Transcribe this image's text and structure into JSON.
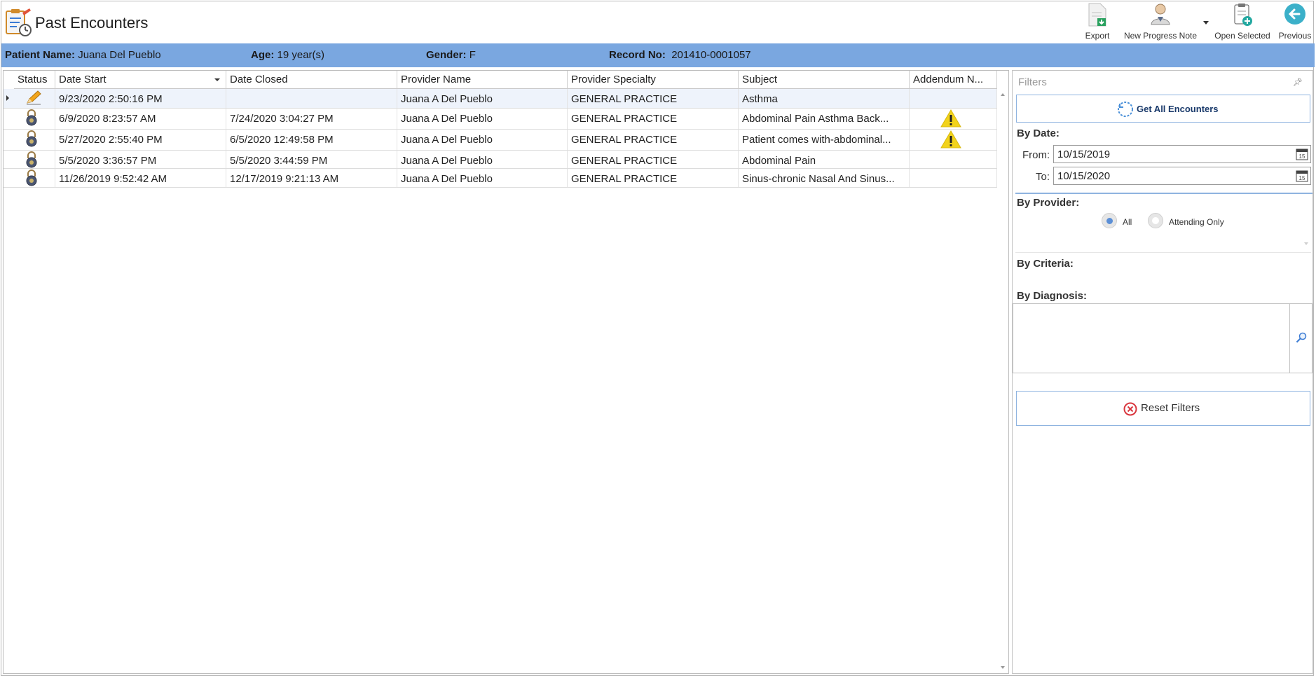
{
  "window": {
    "title": "Past Encounters"
  },
  "toolbar": {
    "export_label": "Export",
    "new_progress_note_label": "New Progress Note",
    "open_selected_label": "Open Selected",
    "previous_label": "Previous"
  },
  "patient": {
    "name_label": "Patient Name:",
    "name_value": "Juana Del Pueblo",
    "age_label": "Age:",
    "age_value": "19 year(s)",
    "gender_label": "Gender:",
    "gender_value": "F",
    "record_label": "Record No:",
    "record_value": "201410-0001057"
  },
  "grid": {
    "columns": [
      "Status",
      "Date Start",
      "Date Closed",
      "Provider Name",
      "Provider Specialty",
      "Subject",
      "Addendum N..."
    ],
    "rows": [
      {
        "status_icon": "pencil-icon",
        "date_start": "9/23/2020 2:50:16 PM",
        "date_closed": "",
        "provider": "Juana A Del Pueblo",
        "specialty": "GENERAL PRACTICE",
        "subject": "Asthma",
        "addendum_icon": ""
      },
      {
        "status_icon": "lock-icon",
        "date_start": "6/9/2020 8:23:57 AM",
        "date_closed": "7/24/2020 3:04:27 PM",
        "provider": "Juana A Del Pueblo",
        "specialty": "GENERAL PRACTICE",
        "subject": "Abdominal Pain  Asthma  Back...",
        "addendum_icon": "warning-icon"
      },
      {
        "status_icon": "lock-icon",
        "date_start": "5/27/2020 2:55:40 PM",
        "date_closed": "6/5/2020 12:49:58 PM",
        "provider": "Juana A Del Pueblo",
        "specialty": "GENERAL PRACTICE",
        "subject": "Patient comes with-abdominal...",
        "addendum_icon": "warning-icon"
      },
      {
        "status_icon": "lock-icon",
        "date_start": "5/5/2020 3:36:57 PM",
        "date_closed": "5/5/2020 3:44:59 PM",
        "provider": "Juana A Del Pueblo",
        "specialty": "GENERAL PRACTICE",
        "subject": "Abdominal Pain",
        "addendum_icon": ""
      },
      {
        "status_icon": "lock-icon",
        "date_start": "11/26/2019 9:52:42 AM",
        "date_closed": "12/17/2019 9:21:13 AM",
        "provider": "Juana A Del Pueblo",
        "specialty": "GENERAL PRACTICE",
        "subject": "Sinus-chronic  Nasal And Sinus...",
        "addendum_icon": ""
      }
    ]
  },
  "filters": {
    "title": "Filters",
    "get_all_label": "Get All Encounters",
    "by_date_label": "By Date:",
    "from_label": "From:",
    "from_value": "10/15/2019",
    "to_label": "To:",
    "to_value": "10/15/2020",
    "calendar_day": "15",
    "by_provider_label": "By Provider:",
    "provider_options": [
      "All",
      "Attending Only"
    ],
    "provider_selected": "All",
    "by_criteria_label": "By Criteria:",
    "by_diagnosis_label": "By Diagnosis:",
    "reset_label": "Reset Filters"
  },
  "colors": {
    "patient_bar": "#7aa7e0",
    "accent_border": "#8fb4e0",
    "warning": "#f2d31b",
    "reset_icon": "#d9363e",
    "previous_button": "#3bb0c9"
  }
}
